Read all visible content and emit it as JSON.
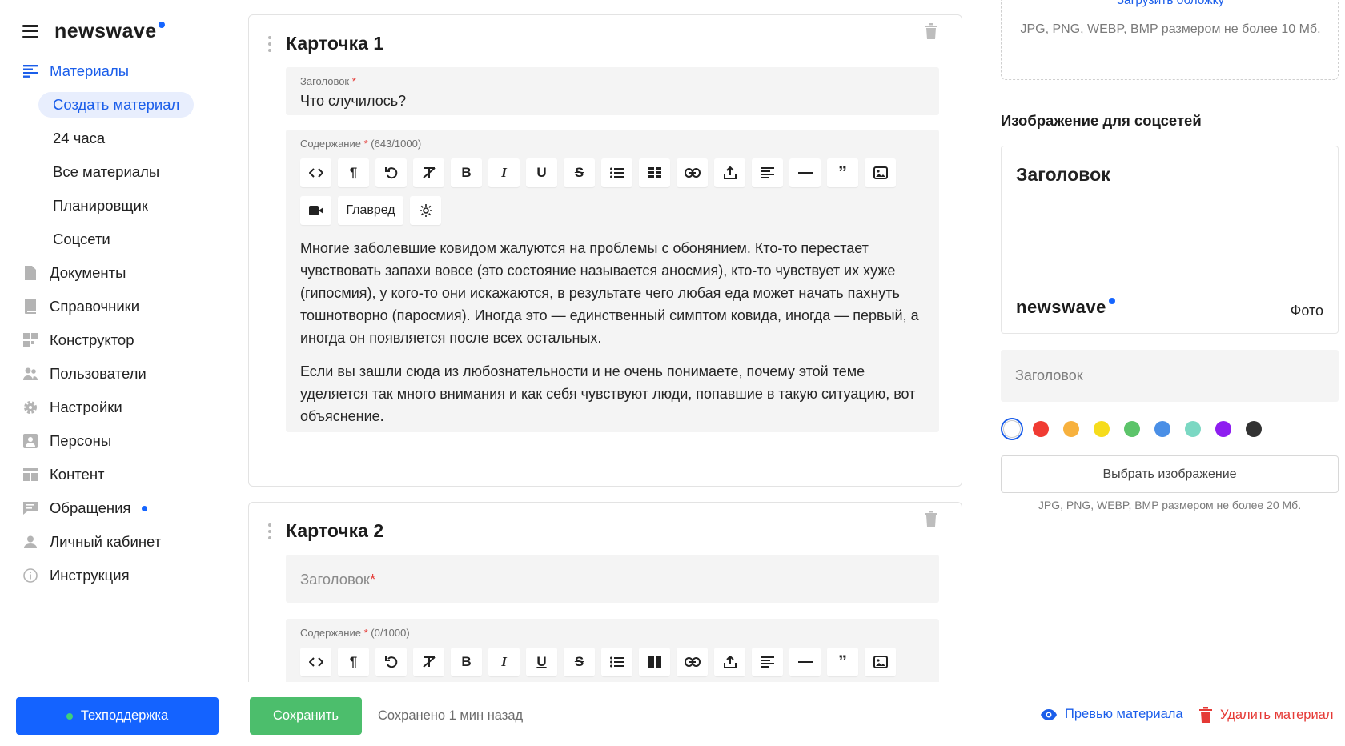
{
  "brand": {
    "name": "newswave",
    "accent": "#1463ff"
  },
  "sidebar": {
    "items": [
      {
        "label": "Материалы",
        "icon": "list-icon",
        "active": true,
        "children": [
          {
            "label": "Создать материал",
            "active": true
          },
          {
            "label": "24 часа"
          },
          {
            "label": "Все материалы"
          },
          {
            "label": "Планировщик"
          },
          {
            "label": "Соцсети"
          }
        ]
      },
      {
        "label": "Документы",
        "icon": "document-icon"
      },
      {
        "label": "Справочники",
        "icon": "book-icon"
      },
      {
        "label": "Конструктор",
        "icon": "grid-icon"
      },
      {
        "label": "Пользователи",
        "icon": "users-icon"
      },
      {
        "label": "Настройки",
        "icon": "gear-icon"
      },
      {
        "label": "Персоны",
        "icon": "person-card-icon"
      },
      {
        "label": "Контент",
        "icon": "layout-icon"
      },
      {
        "label": "Обращения",
        "icon": "chat-icon",
        "badge": true
      },
      {
        "label": "Личный кабинет",
        "icon": "user-icon"
      },
      {
        "label": "Инструкция",
        "icon": "info-icon"
      }
    ],
    "support_label": "Техподдержка"
  },
  "cards": [
    {
      "title": "Карточка 1",
      "heading_label": "Заголовок",
      "heading_value": "Что случилось?",
      "content_label": "Содержание",
      "content_counter": "(643/1000)",
      "toolbar_text_buttons": [
        "Главред"
      ],
      "paragraphs": [
        "Многие заболевшие ковидом жалуются на проблемы с обонянием. Кто-то перестает чувствовать запахи вовсе (это состояние называется аносмия), кто-то чувствует их хуже (гипосмия), у кого-то они искажаются, в результате чего любая еда может начать пахнуть тошнотворно (паросмия). Иногда это — единственный симптом ковида, иногда — первый, а иногда он появляется после всех остальных.",
        "Если вы зашли сюда из любознательности и не очень понимаете, почему этой теме уделяется так много внимания и как себя чувствуют люди, попавшие в такую ситуацию, вот объяснение."
      ]
    },
    {
      "title": "Карточка 2",
      "heading_placeholder": "Заголовок",
      "content_label": "Содержание",
      "content_counter": "(0/1000)"
    }
  ],
  "right_panel": {
    "cover_link": "Загрузить обложку",
    "cover_hint": "JPG, PNG, WEBP, BMP размером не более 10 Мб.",
    "social_title": "Изображение для соцсетей",
    "preview_heading": "Заголовок",
    "preview_logo": "newswave",
    "preview_photo": "Фото",
    "social_input_placeholder": "Заголовок",
    "swatch_colors": [
      "#ffffff",
      "#f03b33",
      "#f7b13e",
      "#f6dc1c",
      "#5cc46a",
      "#4a8fe6",
      "#7bd8c3",
      "#8e1ef0",
      "#333333"
    ],
    "choose_button": "Выбрать изображение",
    "choose_hint": "JPG, PNG, WEBP, BMP размером не более 20 Мб."
  },
  "bottom_bar": {
    "save_label": "Сохранить",
    "saved_status": "Сохранено 1 мин назад",
    "preview_label": "Превью материала",
    "delete_label": "Удалить материал"
  }
}
